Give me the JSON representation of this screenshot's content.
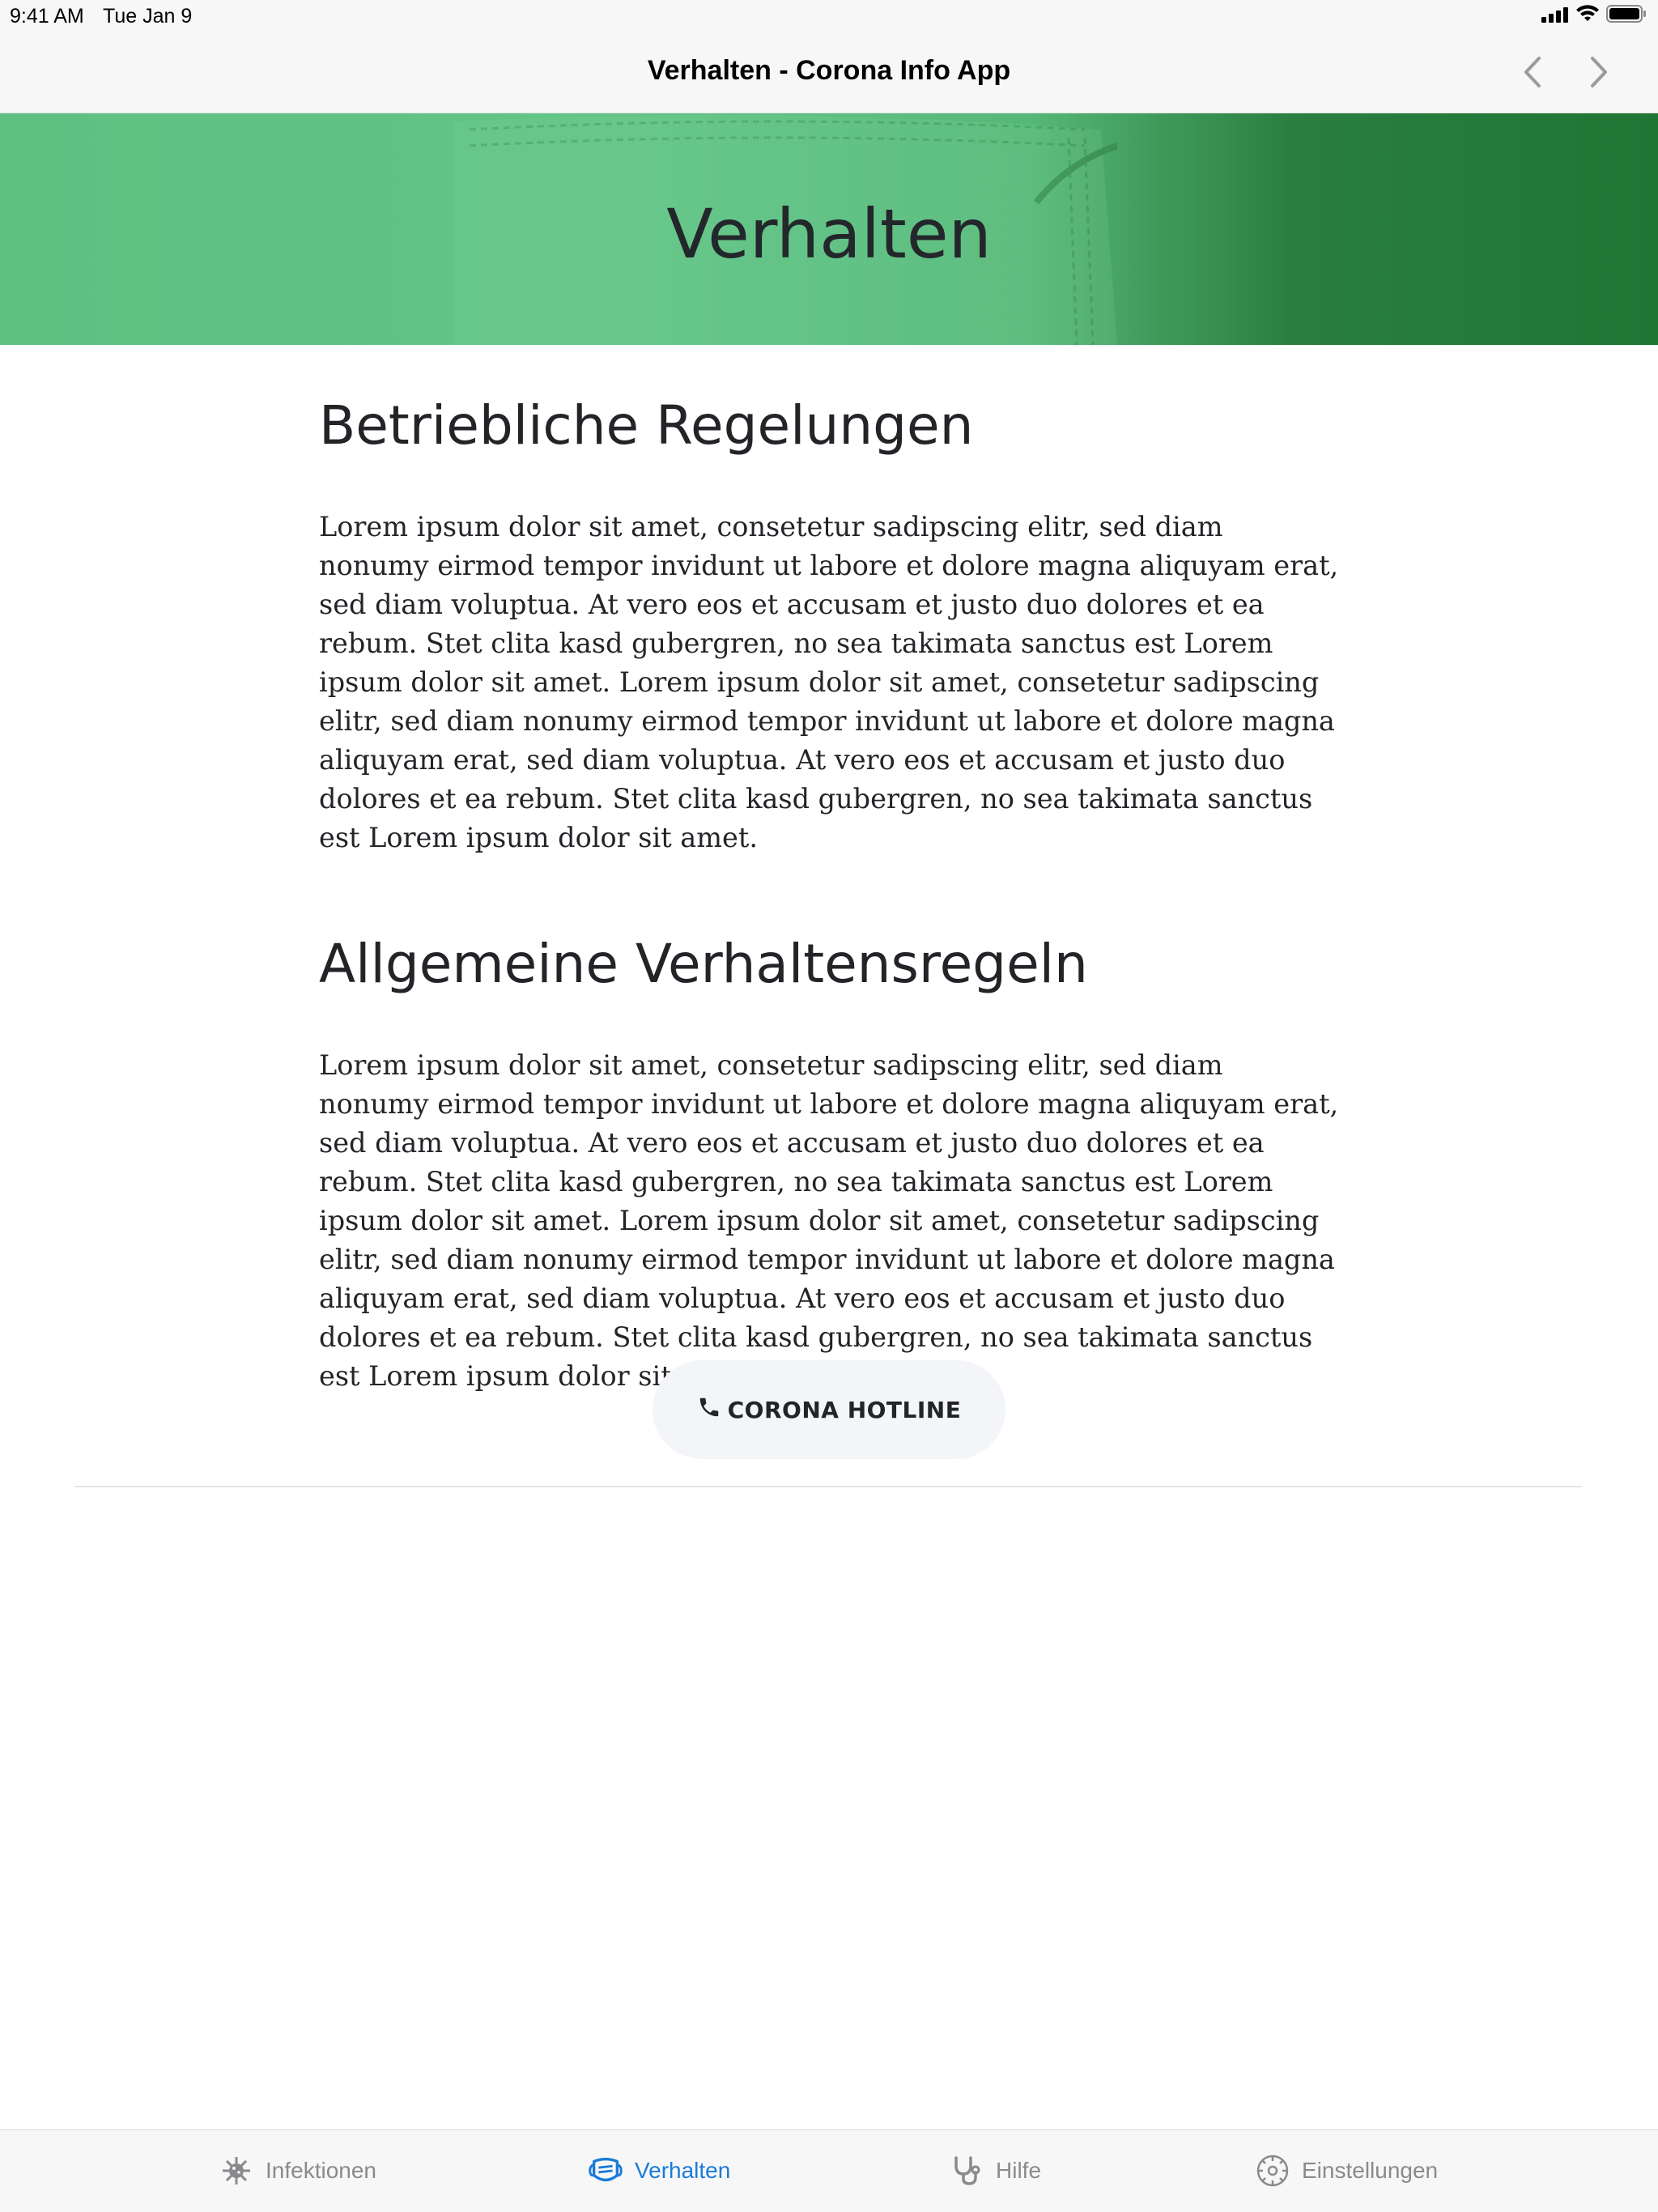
{
  "status_bar": {
    "time": "9:41 AM",
    "date": "Tue Jan 9",
    "icons": [
      "cellular-signal-icon",
      "wifi-icon",
      "battery-icon"
    ]
  },
  "nav": {
    "title": "Verhalten - Corona Info App",
    "back_icon": "chevron-left-icon",
    "forward_icon": "chevron-right-icon"
  },
  "hero": {
    "title": "Verhalten"
  },
  "sections": [
    {
      "heading": "Betriebliche Regelungen",
      "text": "Lorem ipsum dolor sit amet, consetetur sadipscing elitr, sed diam nonumy eirmod tempor invidunt ut labore et dolore magna aliquyam erat, sed diam voluptua. At vero eos et accusam et justo duo dolores et ea rebum. Stet clita kasd gubergren, no sea takimata sanctus est Lorem ipsum dolor sit amet. Lorem ipsum dolor sit amet, consetetur sadipscing elitr, sed diam nonumy eirmod tempor invidunt ut labore et dolore magna aliquyam erat, sed diam voluptua. At vero eos et accusam et justo duo dolores et ea rebum. Stet clita kasd gubergren, no sea takimata sanctus est Lorem ipsum dolor sit amet."
    },
    {
      "heading": "Allgemeine Verhaltensregeln",
      "text": "Lorem ipsum dolor sit amet, consetetur sadipscing elitr, sed diam nonumy eirmod tempor invidunt ut labore et dolore magna aliquyam erat, sed diam voluptua. At vero eos et accusam et justo duo dolores et ea rebum. Stet clita kasd gubergren, no sea takimata sanctus est Lorem ipsum dolor sit amet. Lorem ipsum dolor sit amet, consetetur sadipscing elitr, sed diam nonumy eirmod tempor invidunt ut labore et dolore magna aliquyam erat, sed diam voluptua. At vero eos et accusam et justo duo dolores et ea rebum. Stet clita kasd gubergren, no sea takimata sanctus est Lorem ipsum dolor sit amet."
    }
  ],
  "hotline_button": {
    "label": "CORONA HOTLINE",
    "icon": "phone-icon"
  },
  "tab_bar": {
    "active": "Verhalten",
    "items": [
      {
        "label": "Infektionen",
        "icon": "virus-icon"
      },
      {
        "label": "Verhalten",
        "icon": "face-mask-icon"
      },
      {
        "label": "Hilfe",
        "icon": "stethoscope-icon"
      },
      {
        "label": "Einstellungen",
        "icon": "gear-icon"
      }
    ]
  },
  "colors": {
    "accent": "#1a7bd9",
    "hero_green": "#5fc082",
    "hero_dark_green": "#1f7633",
    "text": "#222428",
    "tab_inactive": "#8a8a8e"
  }
}
